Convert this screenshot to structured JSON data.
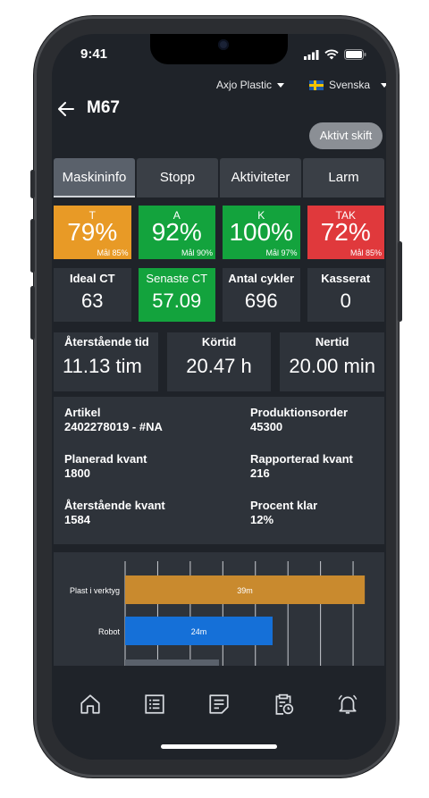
{
  "status_bar": {
    "time": "9:41"
  },
  "topbar": {
    "company": "Axjo Plastic",
    "language": "Svenska"
  },
  "header": {
    "title": "M67",
    "shift_button": "Aktivt skift"
  },
  "tabs": [
    {
      "label": "Maskininfo",
      "active": true
    },
    {
      "label": "Stopp",
      "active": false
    },
    {
      "label": "Aktiviteter",
      "active": false
    },
    {
      "label": "Larm",
      "active": false
    }
  ],
  "kpis": [
    {
      "label": "T",
      "value": "79%",
      "goal": "Mål 85%",
      "color": "#e89a26"
    },
    {
      "label": "A",
      "value": "92%",
      "goal": "Mål 90%",
      "color": "#13a33d"
    },
    {
      "label": "K",
      "value": "100%",
      "goal": "Mål 97%",
      "color": "#13a33d"
    },
    {
      "label": "TAK",
      "value": "72%",
      "goal": "Mål 85%",
      "color": "#e0393c"
    }
  ],
  "cards": [
    {
      "label": "Ideal CT",
      "value": "63"
    },
    {
      "label": "Senaste CT",
      "value": "57.09"
    },
    {
      "label": "Antal cykler",
      "value": "696"
    },
    {
      "label": "Kasserat",
      "value": "0"
    }
  ],
  "times": [
    {
      "label": "Återstående tid",
      "value": "11.13 tim"
    },
    {
      "label": "Körtid",
      "value": "20.47 h"
    },
    {
      "label": "Nertid",
      "value": "20.00 min"
    }
  ],
  "info": {
    "artikel_label": "Artikel",
    "artikel_value": "2402278019 - #NA",
    "order_label": "Produktionsorder",
    "order_value": "45300",
    "planerad_label": "Planerad kvant",
    "planerad_value": "1800",
    "rapporterad_label": "Rapporterad kvant",
    "rapporterad_value": "216",
    "aterstaende_label": "Återstående kvant",
    "aterstaende_value": "1584",
    "procent_label": "Procent klar",
    "procent_value": "12%"
  },
  "chart_data": {
    "type": "bar",
    "orientation": "horizontal",
    "categories": [
      "Plast i verktyg",
      "Robot"
    ],
    "values": [
      39,
      24
    ],
    "value_labels": [
      "39m",
      "24m"
    ],
    "colors": [
      "#c98a2e",
      "#1570d8"
    ],
    "xlim": [
      0,
      40
    ]
  },
  "nav": [
    {
      "icon": "home-icon"
    },
    {
      "icon": "list-icon"
    },
    {
      "icon": "document-icon"
    },
    {
      "icon": "clipboard-clock-icon"
    },
    {
      "icon": "alarm-bell-icon"
    }
  ]
}
